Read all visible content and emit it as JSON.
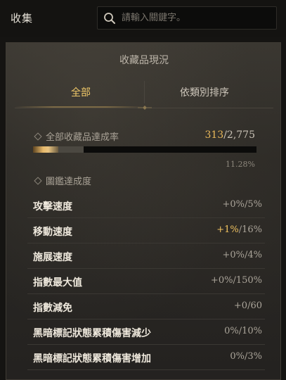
{
  "header": {
    "title": "收集",
    "search_placeholder": "請輸入關鍵字。"
  },
  "panel": {
    "title": "收藏品現況",
    "tabs": [
      {
        "label": "全部",
        "active": true
      },
      {
        "label": "依類別排序",
        "active": false
      }
    ]
  },
  "completion": {
    "label": "全部收藏品達成率",
    "collected": "313",
    "total": "/2,775",
    "percent_text": "11.28%",
    "progress": 0.1128
  },
  "codex": {
    "label": "圖鑑達成度",
    "stats": [
      {
        "name": "攻擊速度",
        "current": "+0%",
        "max": "/5%",
        "highlight": false
      },
      {
        "name": "移動速度",
        "current": "+1%",
        "max": "/16%",
        "highlight": true
      },
      {
        "name": "施展速度",
        "current": "+0%",
        "max": "/4%",
        "highlight": false
      },
      {
        "name": "指數最大值",
        "current": "+0%",
        "max": "/150%",
        "highlight": false
      },
      {
        "name": "指數減免",
        "current": "+0",
        "max": "/60",
        "highlight": false
      },
      {
        "name": "黑暗標記狀態累積傷害減少",
        "current": "0%",
        "max": "/10%",
        "highlight": false
      },
      {
        "name": "黑暗標記狀態累積傷害增加",
        "current": "0%",
        "max": "/3%",
        "highlight": false
      }
    ]
  },
  "colors": {
    "accent_gold": "#f0c969",
    "panel_bg": "#2b2925",
    "page_bg": "#151412"
  }
}
